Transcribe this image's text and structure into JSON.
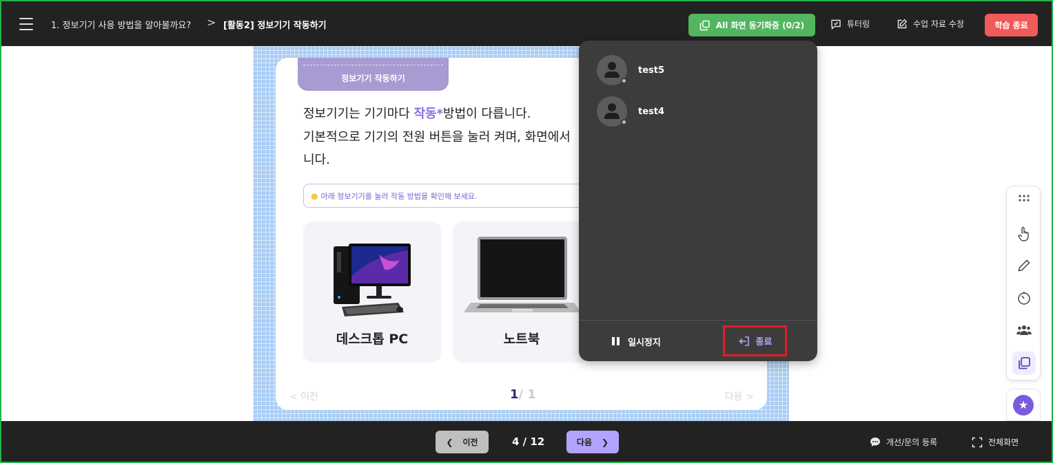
{
  "header": {
    "breadcrumb_lesson": "1. 정보기기 사용 방법을 알아볼까요?",
    "breadcrumb_separator": ">",
    "breadcrumb_activity": "[활동2] 정보기기 작동하기",
    "sync_button": "All 화면 동기화중 (0/2)",
    "tutoring": "튜터링",
    "edit_material": "수업 자료 수정",
    "end_class": "학습 종료"
  },
  "slide": {
    "tag": "정보기기 작동하기",
    "line1_before": "정보기기는 기기마다 ",
    "line1_highlight": "작동*",
    "line1_after": "방법이 다릅니다.",
    "line2": "기본적으로 기기의 전원 버튼을 눌러 켜며, 화면에서",
    "line3": "니다.",
    "hint": "아래 정보기기를 눌러 작동 방법을 확인해 보세요.",
    "devices": [
      {
        "label": "데스크톱 PC"
      },
      {
        "label": "노트북"
      }
    ],
    "pager_prev": "< 이전",
    "pager_next": "다음 >",
    "pager_current": "1",
    "pager_total": "/ 1"
  },
  "popup": {
    "users": [
      {
        "name": "test5"
      },
      {
        "name": "test4"
      }
    ],
    "pause": "일시정지",
    "stop": "종료"
  },
  "footer": {
    "prev": "이전",
    "page": "4 / 12",
    "next": "다음",
    "feedback": "개선/문의 등록",
    "fullscreen": "전체화면"
  },
  "colors": {
    "topbar": "#222222",
    "sync_green": "#52b560",
    "end_red": "#f15a5a",
    "accent_purple": "#8c6fe0",
    "popup_bg": "#3c3c3c",
    "stop_highlight": "#e11d2a"
  },
  "icons": {
    "menu": "hamburger-icon",
    "sync": "copy-windows-icon",
    "tutoring": "chat-check-icon",
    "edit": "edit-icon",
    "pause": "pause-icon",
    "stop": "exit-icon",
    "toolbar": [
      "dots-icon",
      "hand-pointer-icon",
      "pencil-icon",
      "timer-icon",
      "group-icon",
      "windows-icon"
    ],
    "ai": "ai-star-icon"
  }
}
